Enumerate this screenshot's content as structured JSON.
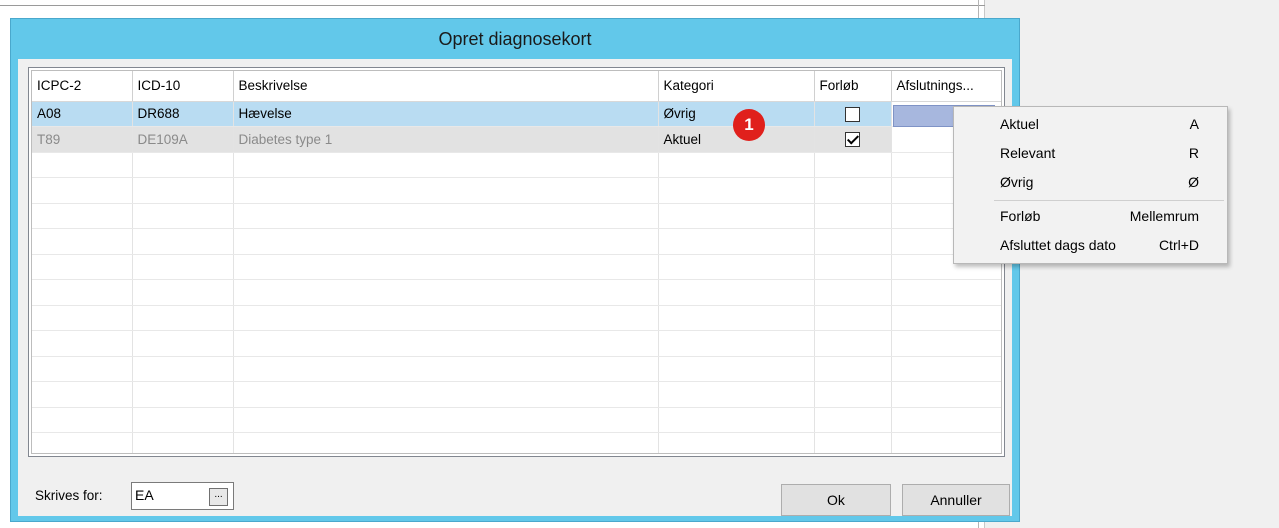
{
  "dialog": {
    "title": "Opret diagnosekort"
  },
  "grid": {
    "columns": [
      "ICPC-2",
      "ICD-10",
      "Beskrivelse",
      "Kategori",
      "Forløb",
      "Afslutnings..."
    ],
    "rows": [
      {
        "icpc": "A08",
        "icd": "DR688",
        "desc": "Hævelse",
        "kategori": "Øvrig",
        "forlob": false
      },
      {
        "icpc": "T89",
        "icd": "DE109A",
        "desc": "Diabetes type 1",
        "kategori": "Aktuel",
        "forlob": true
      }
    ]
  },
  "badge": {
    "label": "1"
  },
  "footer": {
    "skrives_for_label": "Skrives for:",
    "skrives_for_value": "EA",
    "browse_label": "...",
    "ok_label": "Ok",
    "cancel_label": "Annuller"
  },
  "context_menu": {
    "items": [
      {
        "label": "Aktuel",
        "shortcut": "A"
      },
      {
        "label": "Relevant",
        "shortcut": "R"
      },
      {
        "label": "Øvrig",
        "shortcut": "Ø"
      },
      {
        "label": "Forløb",
        "shortcut": "Mellemrum"
      },
      {
        "label": "Afsluttet dags dato",
        "shortcut": "Ctrl+D"
      }
    ]
  },
  "colors": {
    "dialog_frame": "#62c8ea",
    "selected_row": "#b9dcf2",
    "badge": "#e0201c"
  }
}
